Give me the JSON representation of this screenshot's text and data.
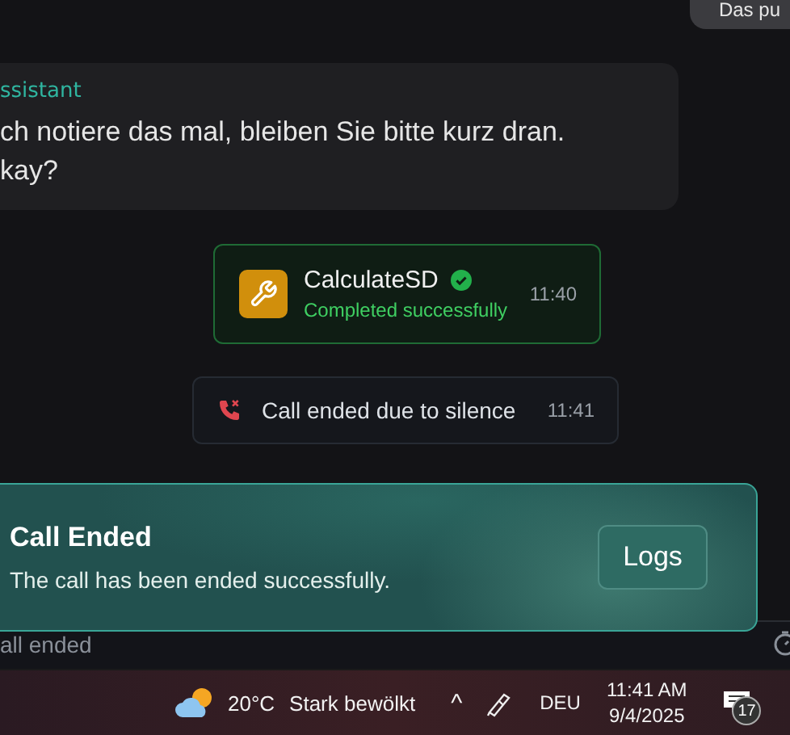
{
  "user_message": {
    "text": "Das pu"
  },
  "assistant_message": {
    "sender": "ssistant",
    "lines": [
      "ch notiere das mal, bleiben Sie bitte kurz dran.",
      "kay?"
    ]
  },
  "tool_call": {
    "name": "CalculateSD",
    "status": "Completed successfully",
    "completed": true,
    "time": "11:40"
  },
  "call_event": {
    "text": "Call ended due to silence",
    "time": "11:41"
  },
  "toast": {
    "title": "Call Ended",
    "message": "The call has been ended successfully.",
    "button": "Logs"
  },
  "status_bar": {
    "text": "all ended"
  },
  "taskbar": {
    "temperature": "20°C",
    "weather": "Stark bewölkt",
    "chevron": "^",
    "language": "DEU",
    "time": "11:41 AM",
    "date": "9/4/2025",
    "notification_count": "17"
  }
}
